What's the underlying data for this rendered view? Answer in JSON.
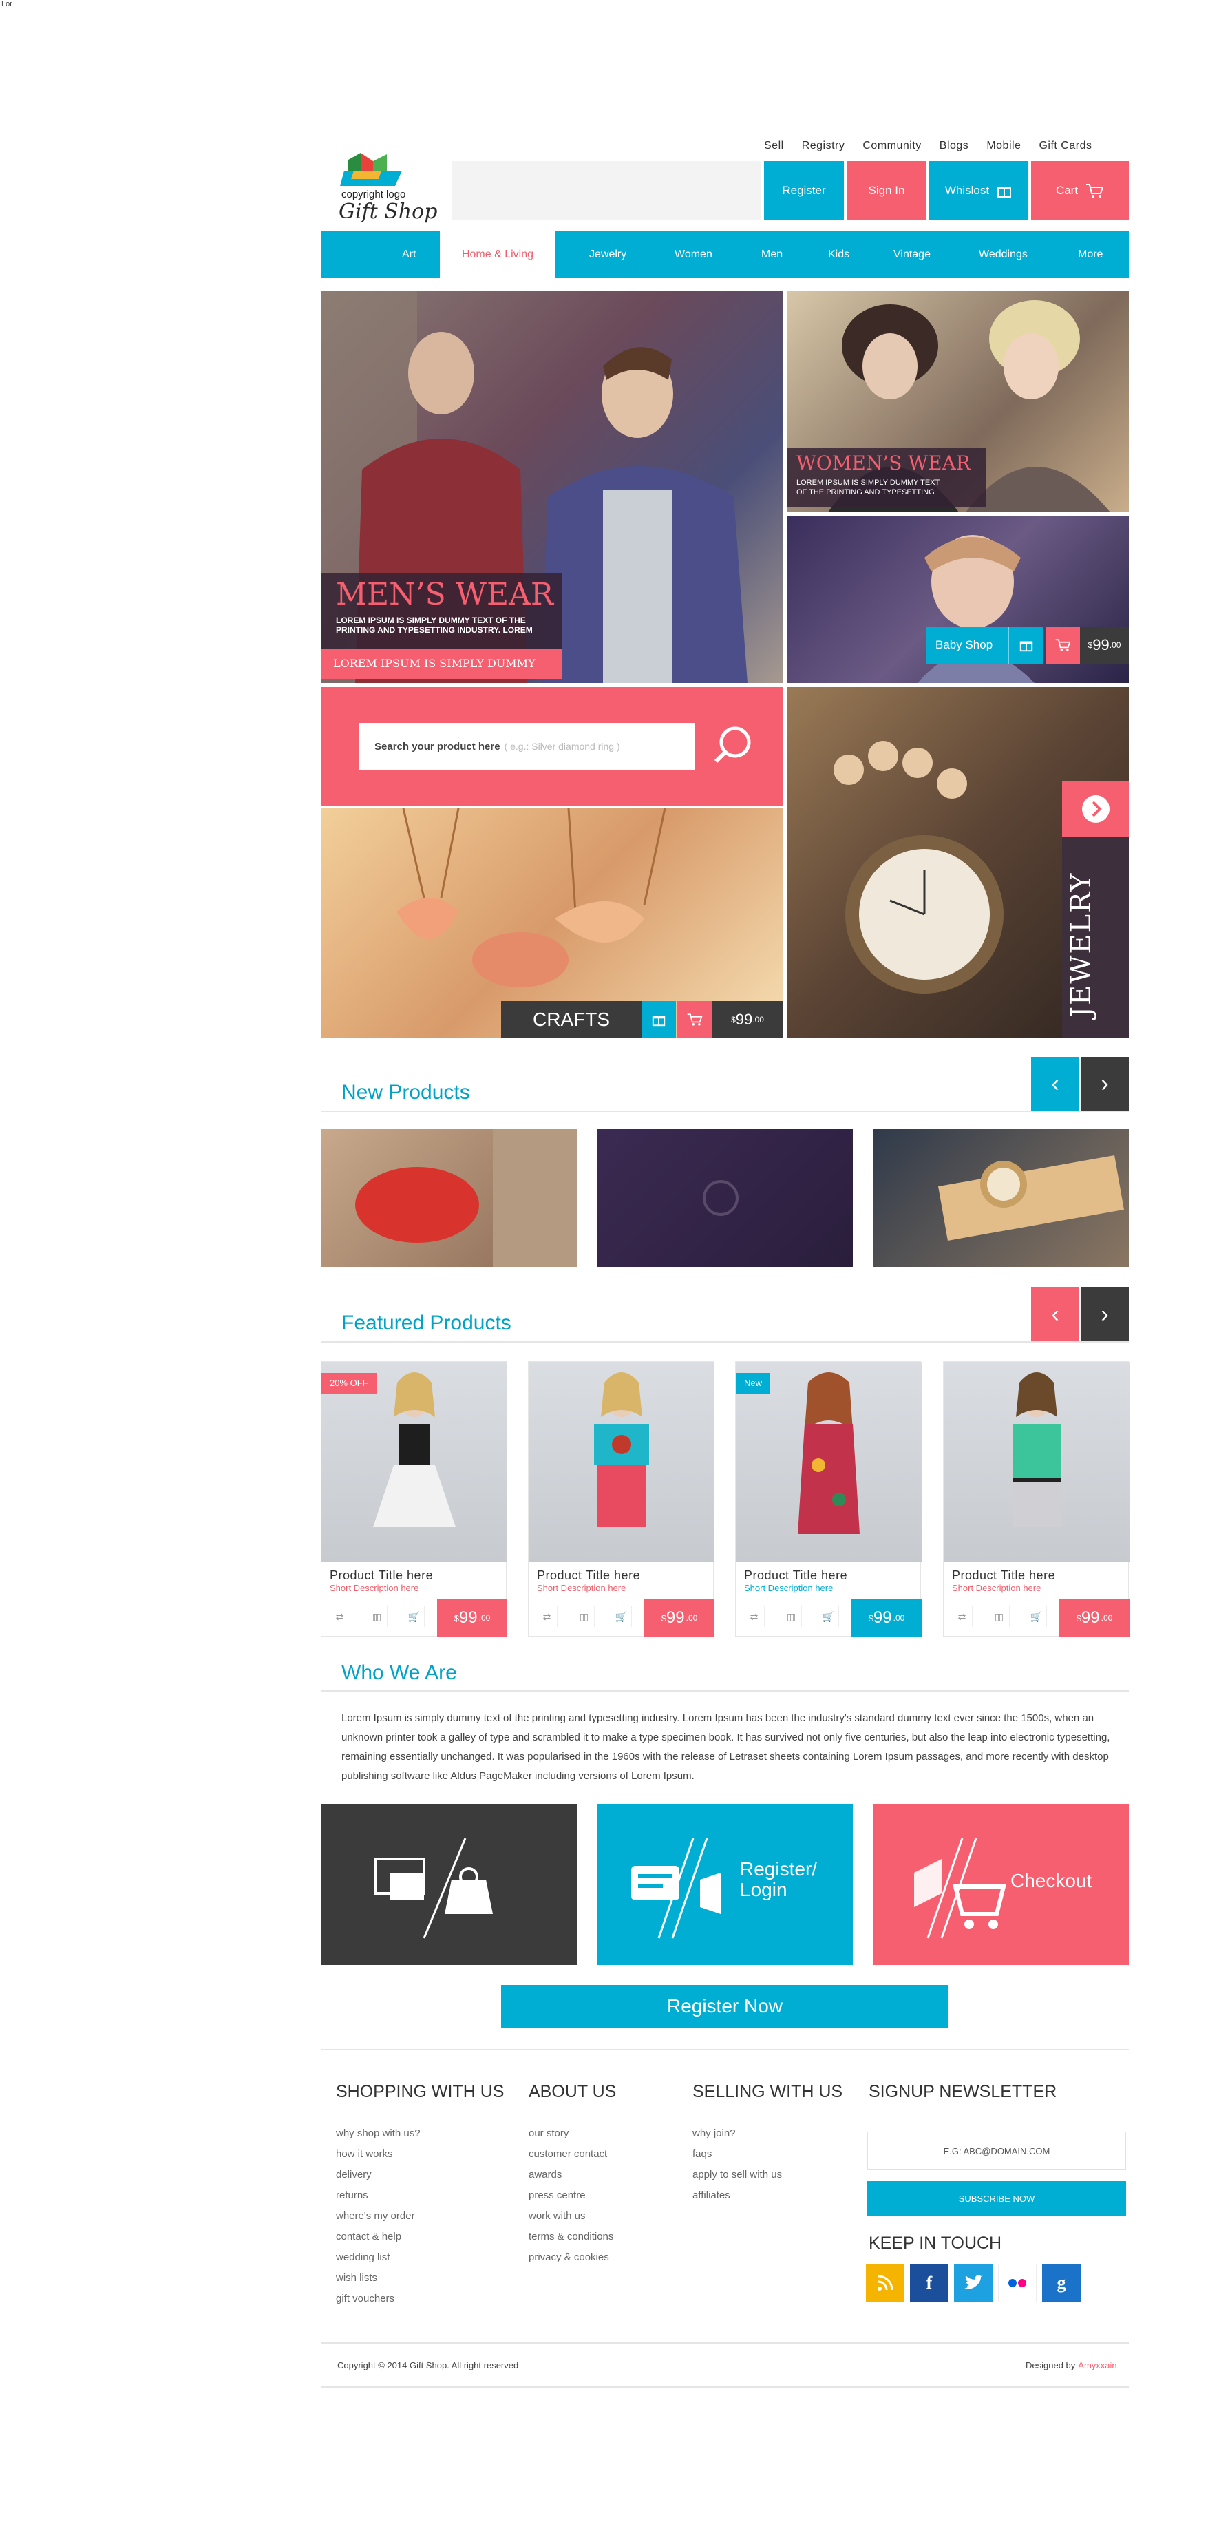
{
  "corner_text": "Lor",
  "top_links": [
    "Sell",
    "Registry",
    "Community",
    "Blogs",
    "Mobile",
    "Gift Cards"
  ],
  "logo": {
    "line1": "copyright logo",
    "line2": "Gift Shop"
  },
  "header": {
    "register": "Register",
    "sign_in": "Sign In",
    "wishlist": "Whislost",
    "cart": "Cart"
  },
  "nav": [
    "Art",
    "Home & Living",
    "Jewelry",
    "Women",
    "Men",
    "Kids",
    "Vintage",
    "Weddings",
    "More"
  ],
  "hero": {
    "mens_title": "MEN’S WEAR",
    "mens_text": "LOREM IPSUM IS SIMPLY DUMMY TEXT OF THE PRINTING AND TYPESETTING INDUSTRY. LOREM",
    "mens_tag": "LOREM IPSUM IS SIMPLY DUMMY TEXT",
    "womens_title": "WOMEN’S WEAR",
    "womens_text": "LOREM IPSUM IS SIMPLY DUMMY TEXT OF THE PRINTING AND TYPESETTING",
    "baby_label": "Baby Shop",
    "baby_price": "99",
    "search_label": "Search your product here",
    "search_hint": "( e.g.: Silver diamond ring )",
    "crafts_label": "CRAFTS",
    "crafts_price": "99",
    "jewelry_label": "JEWELRY"
  },
  "new_products": {
    "title": "New Products"
  },
  "featured": {
    "title": "Featured Products",
    "cards": [
      {
        "badge": "20% OFF",
        "title": "Product Title here",
        "sub": "Short Description here",
        "price": "99"
      },
      {
        "badge": "",
        "title": "Product Title here",
        "sub": "Short Description here",
        "price": "99"
      },
      {
        "badge": "New",
        "title": "Product Title here",
        "sub": "Short Description here",
        "price": "99"
      },
      {
        "badge": "",
        "title": "Product Title here",
        "sub": "Short Description here",
        "price": "99"
      }
    ],
    "cents": ".00",
    "currency": "$"
  },
  "who": {
    "title": "Who We Are",
    "text": "Lorem Ipsum is simply dummy text of the printing and typesetting industry. Lorem Ipsum has been the industry's standard dummy text ever since the 1500s, when an unknown printer took a galley of type and scrambled it to make a type specimen book. It has survived not only five centuries, but also the leap into electronic typesetting, remaining essentially unchanged. It was popularised in the 1960s with the release of Letraset sheets containing Lorem Ipsum passages, and more recently with desktop publishing software like Aldus PageMaker including versions of Lorem Ipsum."
  },
  "tiles": {
    "register": "Register/",
    "login": "Login",
    "checkout": "Checkout"
  },
  "register_now": "Register Now",
  "footer": {
    "shopping": {
      "title": "SHOPPING WITH US",
      "links": [
        "why shop with us?",
        "how it works",
        "delivery",
        "returns",
        "where's my order",
        "contact & help",
        "wedding list",
        "wish lists",
        "gift vouchers"
      ]
    },
    "about": {
      "title": "ABOUT US",
      "links": [
        "our story",
        "customer contact",
        "awards",
        "press centre",
        "work with us",
        "terms & conditions",
        "privacy & cookies"
      ]
    },
    "selling": {
      "title": "SELLING WITH US",
      "links": [
        "why join?",
        "faqs",
        "apply to sell with us",
        "affiliates"
      ]
    },
    "newsletter": {
      "title": "SIGNUP NEWSLETTER",
      "placeholder": "E.G: ABC@DOMAIN.COM",
      "button": "SUBSCRIBE NOW"
    },
    "keep_title": "KEEP IN TOUCH",
    "copyright": "Copyright © 2014 Gift Shop.  All right reserved",
    "designed_by": "Designed by",
    "designer": "Amyxxain"
  },
  "colors": {
    "cyan": "#00aed4",
    "pink": "#f65f6f",
    "dark": "#3b3b3b"
  }
}
